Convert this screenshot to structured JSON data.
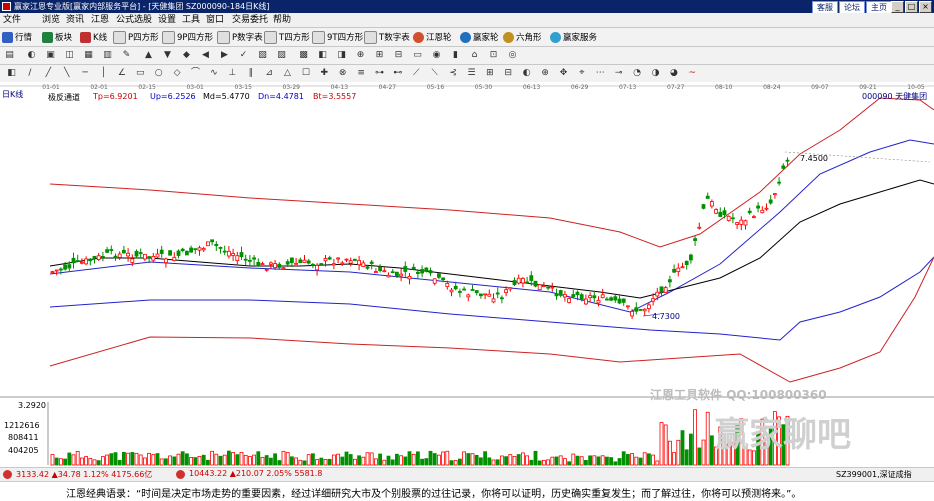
{
  "window": {
    "title": "赢家江恩专业版[赢家内部服务平台] - [天健集团  SZ000090-184日K线]",
    "links": [
      "客服",
      "论坛",
      "主页"
    ],
    "buttons": [
      "_",
      "□",
      "×"
    ]
  },
  "menu": [
    "文件",
    "浏览",
    "资讯",
    "江恩",
    "公式选股",
    "设置",
    "工具",
    "窗口",
    "交易委托",
    "帮助"
  ],
  "toolbar1": [
    "行情",
    "板块",
    "K线",
    "P四方形",
    "9P四方形",
    "P数字表",
    "T四方形",
    "9T四方形",
    "T数字表",
    "江恩轮",
    "赢家轮",
    "六角形",
    "赢家服务"
  ],
  "chart": {
    "period": "日K线",
    "indicator": {
      "name": "极反通道",
      "tp": "Tp=6.9201",
      "up": "Up=6.2526",
      "md": "Md=5.4770",
      "dn": "Dn=4.4781",
      "bt": "Bt=3.5557"
    },
    "stock_label": "000090  天健集团",
    "dates": [
      "01-01",
      "02-01",
      "02-15",
      "03-01",
      "03-15",
      "03-29",
      "04-13",
      "04-27",
      "05-16",
      "05-30",
      "06-13",
      "06-29",
      "07-13",
      "07-27",
      "08-10",
      "08-24",
      "09-07",
      "09-21",
      "10-05"
    ],
    "high_label": "7.4500",
    "low_label": "4.7300",
    "volume_labels": [
      "3.2920",
      "1212616",
      "808411",
      "404205"
    ],
    "colors": {
      "up": "#ff0000",
      "down": "#009000",
      "red_band": "#cc2222",
      "blue_band": "#2222cc",
      "mid": "#000000"
    }
  },
  "status": {
    "sh": "3133.42",
    "sh_chg": "34.78",
    "sh_pct": "1.12%",
    "sh_amt": "4175.66亿",
    "sz": "10443.22",
    "sz_chg": "210.07",
    "sz_pct": "2.05%",
    "sz_amt": "5581.8",
    "right": "SZ399001,深证成指"
  },
  "watermark": {
    "text1": "江恩工具软件",
    "qq": "QQ:100800360",
    "text2": "赢家聊吧"
  },
  "quote": "江恩经典语录：“时间是决定市场走势的重要因素，经过详细研究大市及个别股票的过往记录，你将可以证明，历史确实重复发生；而了解过往，你将可以预测将来。”。"
}
